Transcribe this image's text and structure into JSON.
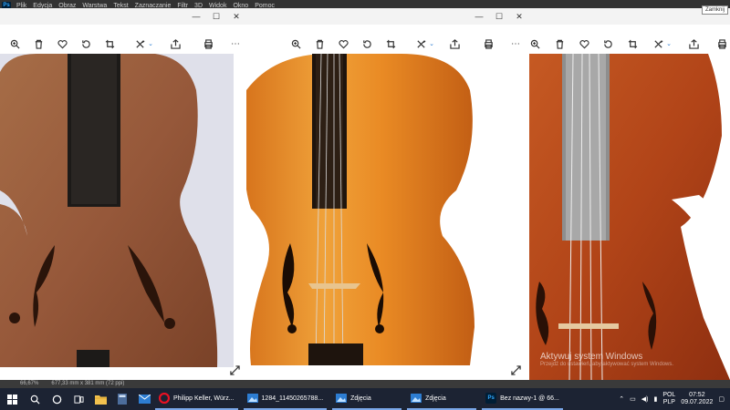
{
  "photoshop": {
    "logo": "Ps",
    "menu": [
      "Plik",
      "Edycja",
      "Obraz",
      "Warstwa",
      "Tekst",
      "Zaznaczanie",
      "Filtr",
      "3D",
      "Widok",
      "Okno",
      "Pomoc"
    ],
    "tooltip": "Zamknij",
    "status": {
      "zoom": "66,67%",
      "doc_size": "677,33 mm x 381 mm (72 ppi)"
    }
  },
  "windows": [
    {
      "controls": [
        "minimize-icon",
        "maximize-icon",
        "close-icon"
      ]
    },
    {
      "controls": [
        "minimize-icon",
        "maximize-icon",
        "close-icon"
      ]
    },
    {
      "controls": [
        "minimize-icon",
        "maximize-icon",
        "close-icon"
      ]
    }
  ],
  "toolbar_icons": [
    "zoom-in-icon",
    "delete-icon",
    "favorite-icon",
    "rotate-icon",
    "crop-icon",
    "edit-icon",
    "share-icon",
    "print-icon",
    "more-icon"
  ],
  "activation": {
    "title": "Aktywuj system Windows",
    "subtitle": "Przejdź do ustawień, aby aktywować system Windows."
  },
  "taskbar": {
    "apps": [
      {
        "label": "Philipp Keller, Würz...",
        "icon": "opera-icon",
        "color": "#e81123"
      },
      {
        "label": "1284_11450265788...",
        "icon": "photos-icon",
        "color": "#2d7dd2"
      },
      {
        "label": "Zdjęcia",
        "icon": "photos-icon",
        "color": "#2d7dd2"
      },
      {
        "label": "Zdjęcia",
        "icon": "photos-icon",
        "color": "#2d7dd2"
      },
      {
        "label": "Bez nazwy-1 @ 66...",
        "icon": "photoshop-icon",
        "color": "#31a8ff"
      }
    ],
    "language": {
      "top": "POL",
      "bottom": "PLP"
    },
    "clock": {
      "time": "07:52",
      "date": "09.07.2022"
    }
  },
  "colors": {
    "taskbar": "#1c2333",
    "ps_bar": "#323232",
    "accent": "#7aa7e8"
  }
}
